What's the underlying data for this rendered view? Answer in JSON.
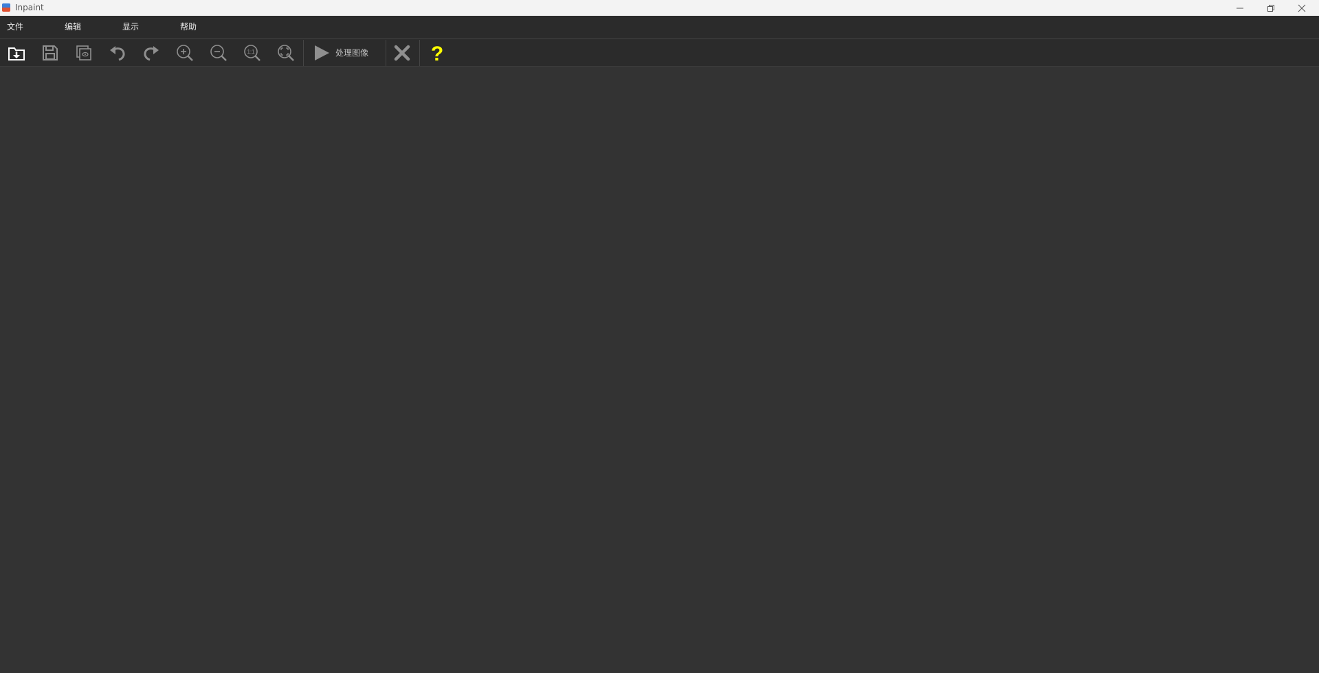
{
  "window": {
    "title": "Inpaint",
    "controls": [
      "minimize",
      "restore",
      "close"
    ]
  },
  "menu": {
    "items": [
      {
        "label": "文件"
      },
      {
        "label": "编辑"
      },
      {
        "label": "显示"
      },
      {
        "label": "帮助"
      }
    ]
  },
  "toolbar": {
    "buttons": [
      {
        "name": "open-icon"
      },
      {
        "name": "save-icon"
      },
      {
        "name": "save-copy-icon"
      },
      {
        "name": "undo-icon"
      },
      {
        "name": "redo-icon"
      },
      {
        "name": "zoom-in-icon"
      },
      {
        "name": "zoom-out-icon"
      },
      {
        "name": "zoom-actual-size-icon"
      },
      {
        "name": "zoom-fit-icon"
      }
    ],
    "process_label": "处理图像",
    "zoom_actual_text": "1:1",
    "help_symbol": "?"
  },
  "colors": {
    "background": "#333333",
    "menubar": "#2b2b2b",
    "titlebar": "#f3f3f3",
    "icon": "#9a9a9a",
    "open_icon": "#ffffff",
    "help_icon": "#ffff00"
  }
}
